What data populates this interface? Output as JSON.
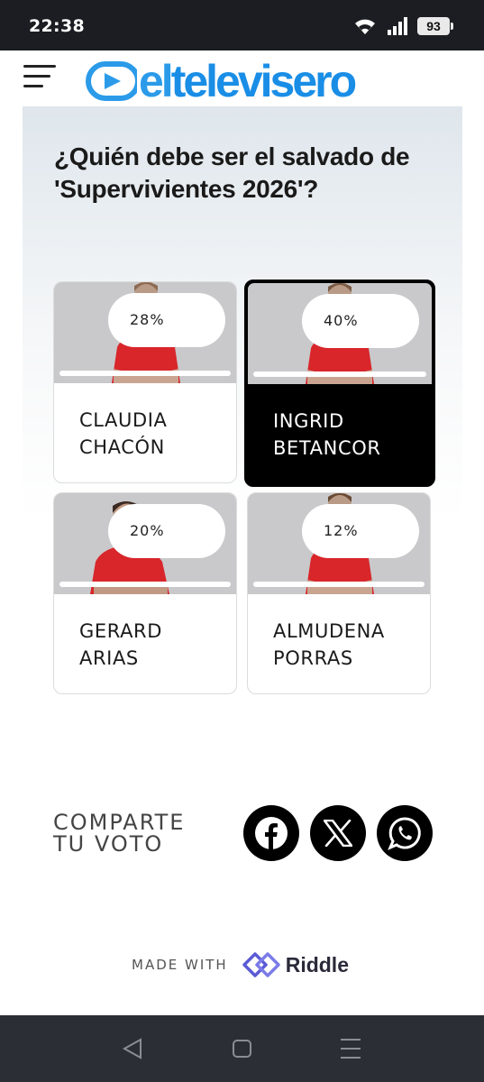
{
  "status_bar": {
    "time": "22:38",
    "battery": "93"
  },
  "header": {
    "logo_el": "el",
    "logo_televisero": "televisero"
  },
  "poll": {
    "question": "¿Quién debe ser el salvado de 'Supervivientes 2026'?",
    "options": [
      {
        "name_line1": "CLAUDIA",
        "name_line2": "CHACÓN",
        "percent": "28%",
        "fraction": 0.28,
        "selected": false
      },
      {
        "name_line1": "INGRID",
        "name_line2": "BETANCOR",
        "percent": "40%",
        "fraction": 0.4,
        "selected": true
      },
      {
        "name_line1": "GERARD",
        "name_line2": "ARIAS",
        "percent": "20%",
        "fraction": 0.2,
        "selected": false
      },
      {
        "name_line1": "ALMUDENA",
        "name_line2": "PORRAS",
        "percent": "12%",
        "fraction": 0.12,
        "selected": false
      }
    ]
  },
  "share": {
    "label_line1": "COMPARTE",
    "label_line2": "TU VOTO",
    "buttons": [
      "facebook-icon",
      "x-icon",
      "whatsapp-icon"
    ]
  },
  "footer": {
    "made_with": "MADE WITH",
    "brand": "Riddle"
  },
  "colors": {
    "brand_blue": "#1a8ee6",
    "jersey_red": "#d8262b",
    "selected_card": "#000000"
  }
}
